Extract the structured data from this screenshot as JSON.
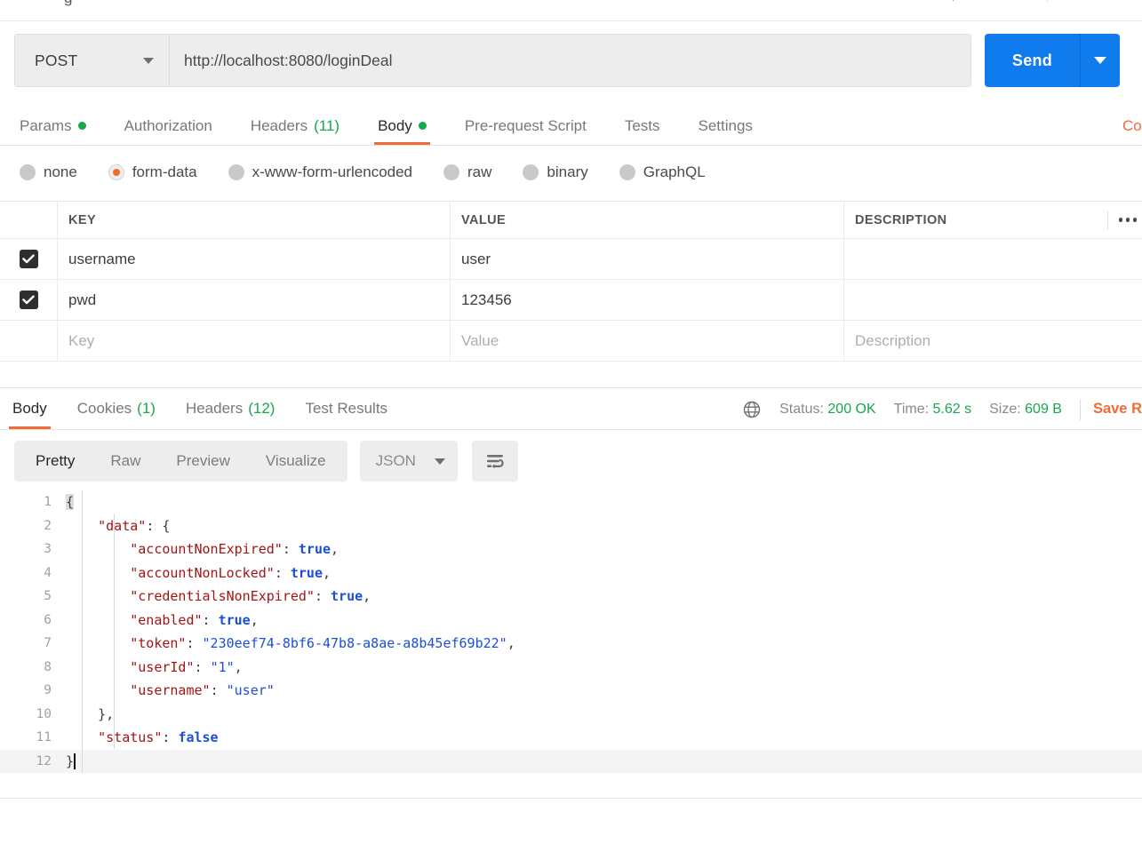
{
  "request": {
    "method": "POST",
    "url": "http://localhost:8080/loginDeal",
    "send_label": "Send",
    "tabs": [
      {
        "label": "Params",
        "badge": "",
        "dot": true,
        "active": false
      },
      {
        "label": "Authorization",
        "badge": "",
        "dot": false,
        "active": false
      },
      {
        "label": "Headers",
        "badge": "(11)",
        "dot": false,
        "active": false
      },
      {
        "label": "Body",
        "badge": "",
        "dot": true,
        "active": true
      },
      {
        "label": "Pre-request Script",
        "badge": "",
        "dot": false,
        "active": false
      },
      {
        "label": "Tests",
        "badge": "",
        "dot": false,
        "active": false
      },
      {
        "label": "Settings",
        "badge": "",
        "dot": false,
        "active": false
      }
    ],
    "cookies_link": "Co",
    "body_types": [
      {
        "label": "none",
        "selected": false
      },
      {
        "label": "form-data",
        "selected": true
      },
      {
        "label": "x-www-form-urlencoded",
        "selected": false
      },
      {
        "label": "raw",
        "selected": false
      },
      {
        "label": "binary",
        "selected": false
      },
      {
        "label": "GraphQL",
        "selected": false
      }
    ],
    "table": {
      "headers": {
        "key": "KEY",
        "value": "VALUE",
        "description": "DESCRIPTION"
      },
      "rows": [
        {
          "checked": true,
          "key": "username",
          "value": "user",
          "description": ""
        },
        {
          "checked": true,
          "key": "pwd",
          "value": "123456",
          "description": ""
        }
      ],
      "placeholders": {
        "key": "Key",
        "value": "Value",
        "description": "Description"
      }
    }
  },
  "response": {
    "tabs": [
      {
        "label": "Body",
        "badge": "",
        "active": true
      },
      {
        "label": "Cookies",
        "badge": "(1)",
        "active": false
      },
      {
        "label": "Headers",
        "badge": "(12)",
        "active": false
      },
      {
        "label": "Test Results",
        "badge": "",
        "active": false
      }
    ],
    "status_label": "Status:",
    "status_value": "200 OK",
    "time_label": "Time:",
    "time_value": "5.62 s",
    "size_label": "Size:",
    "size_value": "609 B",
    "save_response": "Save R",
    "format_tabs": [
      {
        "label": "Pretty",
        "active": true
      },
      {
        "label": "Raw",
        "active": false
      },
      {
        "label": "Preview",
        "active": false
      },
      {
        "label": "Visualize",
        "active": false
      }
    ],
    "language": "JSON",
    "body_lines": [
      {
        "n": "1",
        "text": "{"
      },
      {
        "n": "2",
        "text": "    \"data\": {"
      },
      {
        "n": "3",
        "text": "        \"accountNonExpired\": true,"
      },
      {
        "n": "4",
        "text": "        \"accountNonLocked\": true,"
      },
      {
        "n": "5",
        "text": "        \"credentialsNonExpired\": true,"
      },
      {
        "n": "6",
        "text": "        \"enabled\": true,"
      },
      {
        "n": "7",
        "text": "        \"token\": \"230eef74-8bf6-47b8-a8ae-a8b45ef69b22\","
      },
      {
        "n": "8",
        "text": "        \"userId\": \"1\","
      },
      {
        "n": "9",
        "text": "        \"username\": \"user\""
      },
      {
        "n": "10",
        "text": "    },"
      },
      {
        "n": "11",
        "text": "    \"status\": false"
      },
      {
        "n": "12",
        "text": "}"
      }
    ],
    "json_values": {
      "data": {
        "accountNonExpired": true,
        "accountNonLocked": true,
        "credentialsNonExpired": true,
        "enabled": true,
        "token": "230eef74-8bf6-47b8-a8ae-a8b45ef69b22",
        "userId": "1",
        "username": "user"
      },
      "status": false
    }
  },
  "colors": {
    "accent_orange": "#ef6c36",
    "send_blue": "#0f7bed",
    "status_green": "#17a74b",
    "json_key": "#a31515",
    "json_value": "#1a4fd6"
  }
}
